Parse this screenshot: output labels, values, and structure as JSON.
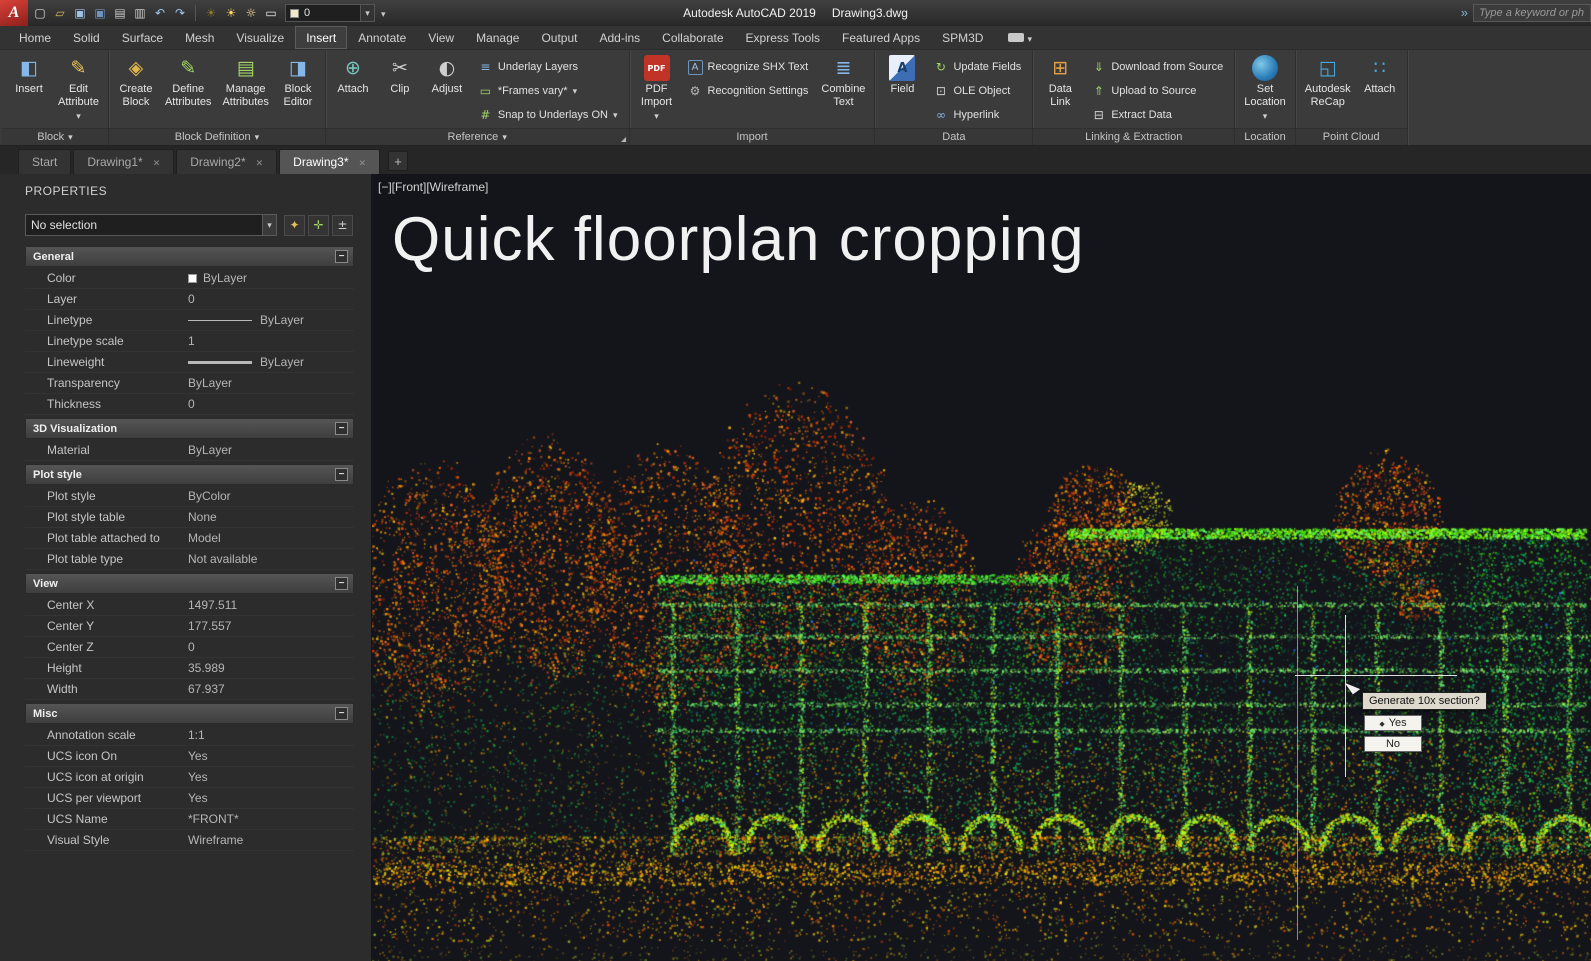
{
  "titlebar": {
    "logo": "A",
    "title": "Autodesk AutoCAD 2019",
    "doc": "Drawing3.dwg",
    "search_placeholder": "Type a keyword or ph",
    "layer_value": "0",
    "qat_icons": [
      {
        "name": "new-file-icon"
      },
      {
        "name": "open-file-icon"
      },
      {
        "name": "save-icon"
      },
      {
        "name": "save-as-icon"
      },
      {
        "name": "plot-icon"
      },
      {
        "name": "print-icon"
      },
      {
        "name": "undo-icon"
      },
      {
        "name": "redo-icon"
      }
    ],
    "workspace_icons": [
      {
        "name": "lamp-dim-icon"
      },
      {
        "name": "lamp-bright-icon"
      },
      {
        "name": "sun-icon"
      },
      {
        "name": "frame-icon"
      }
    ]
  },
  "ribbon": {
    "active_tab": "Insert",
    "tabs": [
      {
        "label": "Home"
      },
      {
        "label": "Solid"
      },
      {
        "label": "Surface"
      },
      {
        "label": "Mesh"
      },
      {
        "label": "Visualize"
      },
      {
        "label": "Insert",
        "active": true
      },
      {
        "label": "Annotate"
      },
      {
        "label": "View"
      },
      {
        "label": "Manage"
      },
      {
        "label": "Output"
      },
      {
        "label": "Add-ins"
      },
      {
        "label": "Collaborate"
      },
      {
        "label": "Express Tools"
      },
      {
        "label": "Featured Apps"
      },
      {
        "label": "SPM3D"
      }
    ],
    "panels": [
      {
        "label": "Block",
        "arrow": true,
        "items": [
          {
            "kind": "big",
            "name": "insert-button",
            "icon": "insert-block-icon",
            "lines": [
              "Insert"
            ]
          },
          {
            "kind": "big",
            "name": "edit-attribute-button",
            "icon": "edit-attribute-icon",
            "lines": [
              "Edit",
              "Attribute"
            ],
            "arrow": true
          }
        ]
      },
      {
        "label": "Block Definition",
        "arrow": true,
        "items": [
          {
            "kind": "big",
            "name": "create-block-button",
            "icon": "create-block-icon",
            "lines": [
              "Create",
              "Block"
            ]
          },
          {
            "kind": "big",
            "name": "define-attributes-button",
            "icon": "define-attributes-icon",
            "lines": [
              "Define",
              "Attributes"
            ]
          },
          {
            "kind": "big",
            "name": "manage-attributes-button",
            "icon": "manage-attributes-icon",
            "lines": [
              "Manage",
              "Attributes"
            ]
          },
          {
            "kind": "big",
            "name": "block-editor-button",
            "icon": "block-editor-icon",
            "lines": [
              "Block",
              "Editor"
            ]
          }
        ]
      },
      {
        "label": "Reference",
        "arrow": true,
        "launcher": true,
        "items": [
          {
            "kind": "big",
            "name": "attach-button",
            "icon": "attach-icon",
            "lines": [
              "Attach"
            ]
          },
          {
            "kind": "big",
            "name": "clip-button",
            "icon": "clip-icon",
            "lines": [
              "Clip"
            ]
          },
          {
            "kind": "big",
            "name": "adjust-button",
            "icon": "adjust-icon",
            "lines": [
              "Adjust"
            ]
          },
          {
            "kind": "col",
            "rows": [
              {
                "name": "underlay-layers-button",
                "icon": "underlay-layers-icon",
                "label": "Underlay Layers"
              },
              {
                "name": "frames-dropdown",
                "icon": "frames-icon",
                "label": "*Frames vary*",
                "arrow": true
              },
              {
                "name": "snap-to-underlays-dropdown",
                "icon": "snap-icon",
                "label": "Snap to Underlays ON",
                "arrow": true
              }
            ]
          }
        ]
      },
      {
        "label": "Import",
        "items": [
          {
            "kind": "big",
            "name": "pdf-import-button",
            "icon": "pdf-icon",
            "lines": [
              "PDF",
              "Import"
            ],
            "arrow": true
          },
          {
            "kind": "col",
            "rows": [
              {
                "name": "recognize-shx-text-button",
                "icon": "recognize-shx-icon",
                "label": "Recognize SHX Text"
              },
              {
                "name": "recognition-settings-button",
                "icon": "recognition-settings-icon",
                "label": "Recognition Settings"
              }
            ]
          },
          {
            "kind": "big",
            "name": "combine-text-button",
            "icon": "combine-text-icon",
            "lines": [
              "Combine",
              "Text"
            ]
          }
        ]
      },
      {
        "label": "Data",
        "items": [
          {
            "kind": "big",
            "name": "field-button",
            "icon": "field-icon",
            "lines": [
              "Field"
            ]
          },
          {
            "kind": "col",
            "rows": [
              {
                "name": "update-fields-button",
                "icon": "update-fields-icon",
                "label": "Update Fields"
              },
              {
                "name": "ole-object-button",
                "icon": "ole-object-icon",
                "label": "OLE Object"
              },
              {
                "name": "hyperlink-button",
                "icon": "hyperlink-icon",
                "label": "Hyperlink"
              }
            ]
          }
        ]
      },
      {
        "label": "Linking & Extraction",
        "items": [
          {
            "kind": "big",
            "name": "data-link-button",
            "icon": "data-link-icon",
            "lines": [
              "Data",
              "Link"
            ]
          },
          {
            "kind": "col",
            "rows": [
              {
                "name": "download-from-source-button",
                "icon": "download-source-icon",
                "label": "Download from Source"
              },
              {
                "name": "upload-to-source-button",
                "icon": "upload-source-icon",
                "label": "Upload to Source"
              },
              {
                "name": "extract-data-button",
                "icon": "extract-data-icon",
                "label": "Extract Data"
              }
            ]
          }
        ]
      },
      {
        "label": "Location",
        "items": [
          {
            "kind": "big",
            "name": "set-location-button",
            "icon": "set-location-icon",
            "lines": [
              "Set",
              "Location"
            ],
            "arrow": true
          }
        ]
      },
      {
        "label": "Point Cloud",
        "items": [
          {
            "kind": "big",
            "name": "autodesk-recap-button",
            "icon": "recap-icon",
            "lines": [
              "Autodesk",
              "ReCap"
            ]
          },
          {
            "kind": "big",
            "name": "attach-point-cloud-button",
            "icon": "attach-pointcloud-icon",
            "lines": [
              "Attach"
            ]
          }
        ]
      }
    ]
  },
  "doc_tabs": {
    "add_label": "+",
    "tabs": [
      {
        "label": "Start"
      },
      {
        "label": "Drawing1*",
        "closable": true
      },
      {
        "label": "Drawing2*",
        "closable": true
      },
      {
        "label": "Drawing3*",
        "closable": true,
        "active": true
      }
    ]
  },
  "properties": {
    "title": "PROPERTIES",
    "selector": "No selection",
    "tools": [
      {
        "name": "quick-select-button",
        "icon": "quick-select-icon"
      },
      {
        "name": "select-objects-button",
        "icon": "select-objects-icon"
      },
      {
        "name": "toggle-pickadd-button",
        "icon": "pickadd-icon"
      }
    ],
    "sections": [
      {
        "title": "General",
        "rows": [
          {
            "label": "Color",
            "value": "ByLayer",
            "swatch": true
          },
          {
            "label": "Layer",
            "value": "0"
          },
          {
            "label": "Linetype",
            "value": "ByLayer",
            "line": "thin"
          },
          {
            "label": "Linetype scale",
            "value": "1"
          },
          {
            "label": "Lineweight",
            "value": "ByLayer",
            "line": "thick"
          },
          {
            "label": "Transparency",
            "value": "ByLayer"
          },
          {
            "label": "Thickness",
            "value": "0"
          }
        ]
      },
      {
        "title": "3D Visualization",
        "rows": [
          {
            "label": "Material",
            "value": "ByLayer"
          }
        ]
      },
      {
        "title": "Plot style",
        "rows": [
          {
            "label": "Plot style",
            "value": "ByColor"
          },
          {
            "label": "Plot style table",
            "value": "None"
          },
          {
            "label": "Plot table attached to",
            "value": "Model"
          },
          {
            "label": "Plot table type",
            "value": "Not available"
          }
        ]
      },
      {
        "title": "View",
        "rows": [
          {
            "label": "Center X",
            "value": "1497.511"
          },
          {
            "label": "Center Y",
            "value": "177.557"
          },
          {
            "label": "Center Z",
            "value": "0"
          },
          {
            "label": "Height",
            "value": "35.989"
          },
          {
            "label": "Width",
            "value": "67.937"
          }
        ]
      },
      {
        "title": "Misc",
        "rows": [
          {
            "label": "Annotation scale",
            "value": "1:1"
          },
          {
            "label": "UCS icon On",
            "value": "Yes"
          },
          {
            "label": "UCS icon at origin",
            "value": "Yes"
          },
          {
            "label": "UCS per viewport",
            "value": "Yes"
          },
          {
            "label": "UCS Name",
            "value": "*FRONT*"
          },
          {
            "label": "Visual Style",
            "value": "Wireframe"
          }
        ]
      }
    ]
  },
  "viewport": {
    "label": "[−][Front][Wireframe]",
    "overlay_title": "Quick floorplan cropping",
    "tooltip": "Generate 10x section?",
    "yes_label": "Yes",
    "no_label": "No"
  }
}
